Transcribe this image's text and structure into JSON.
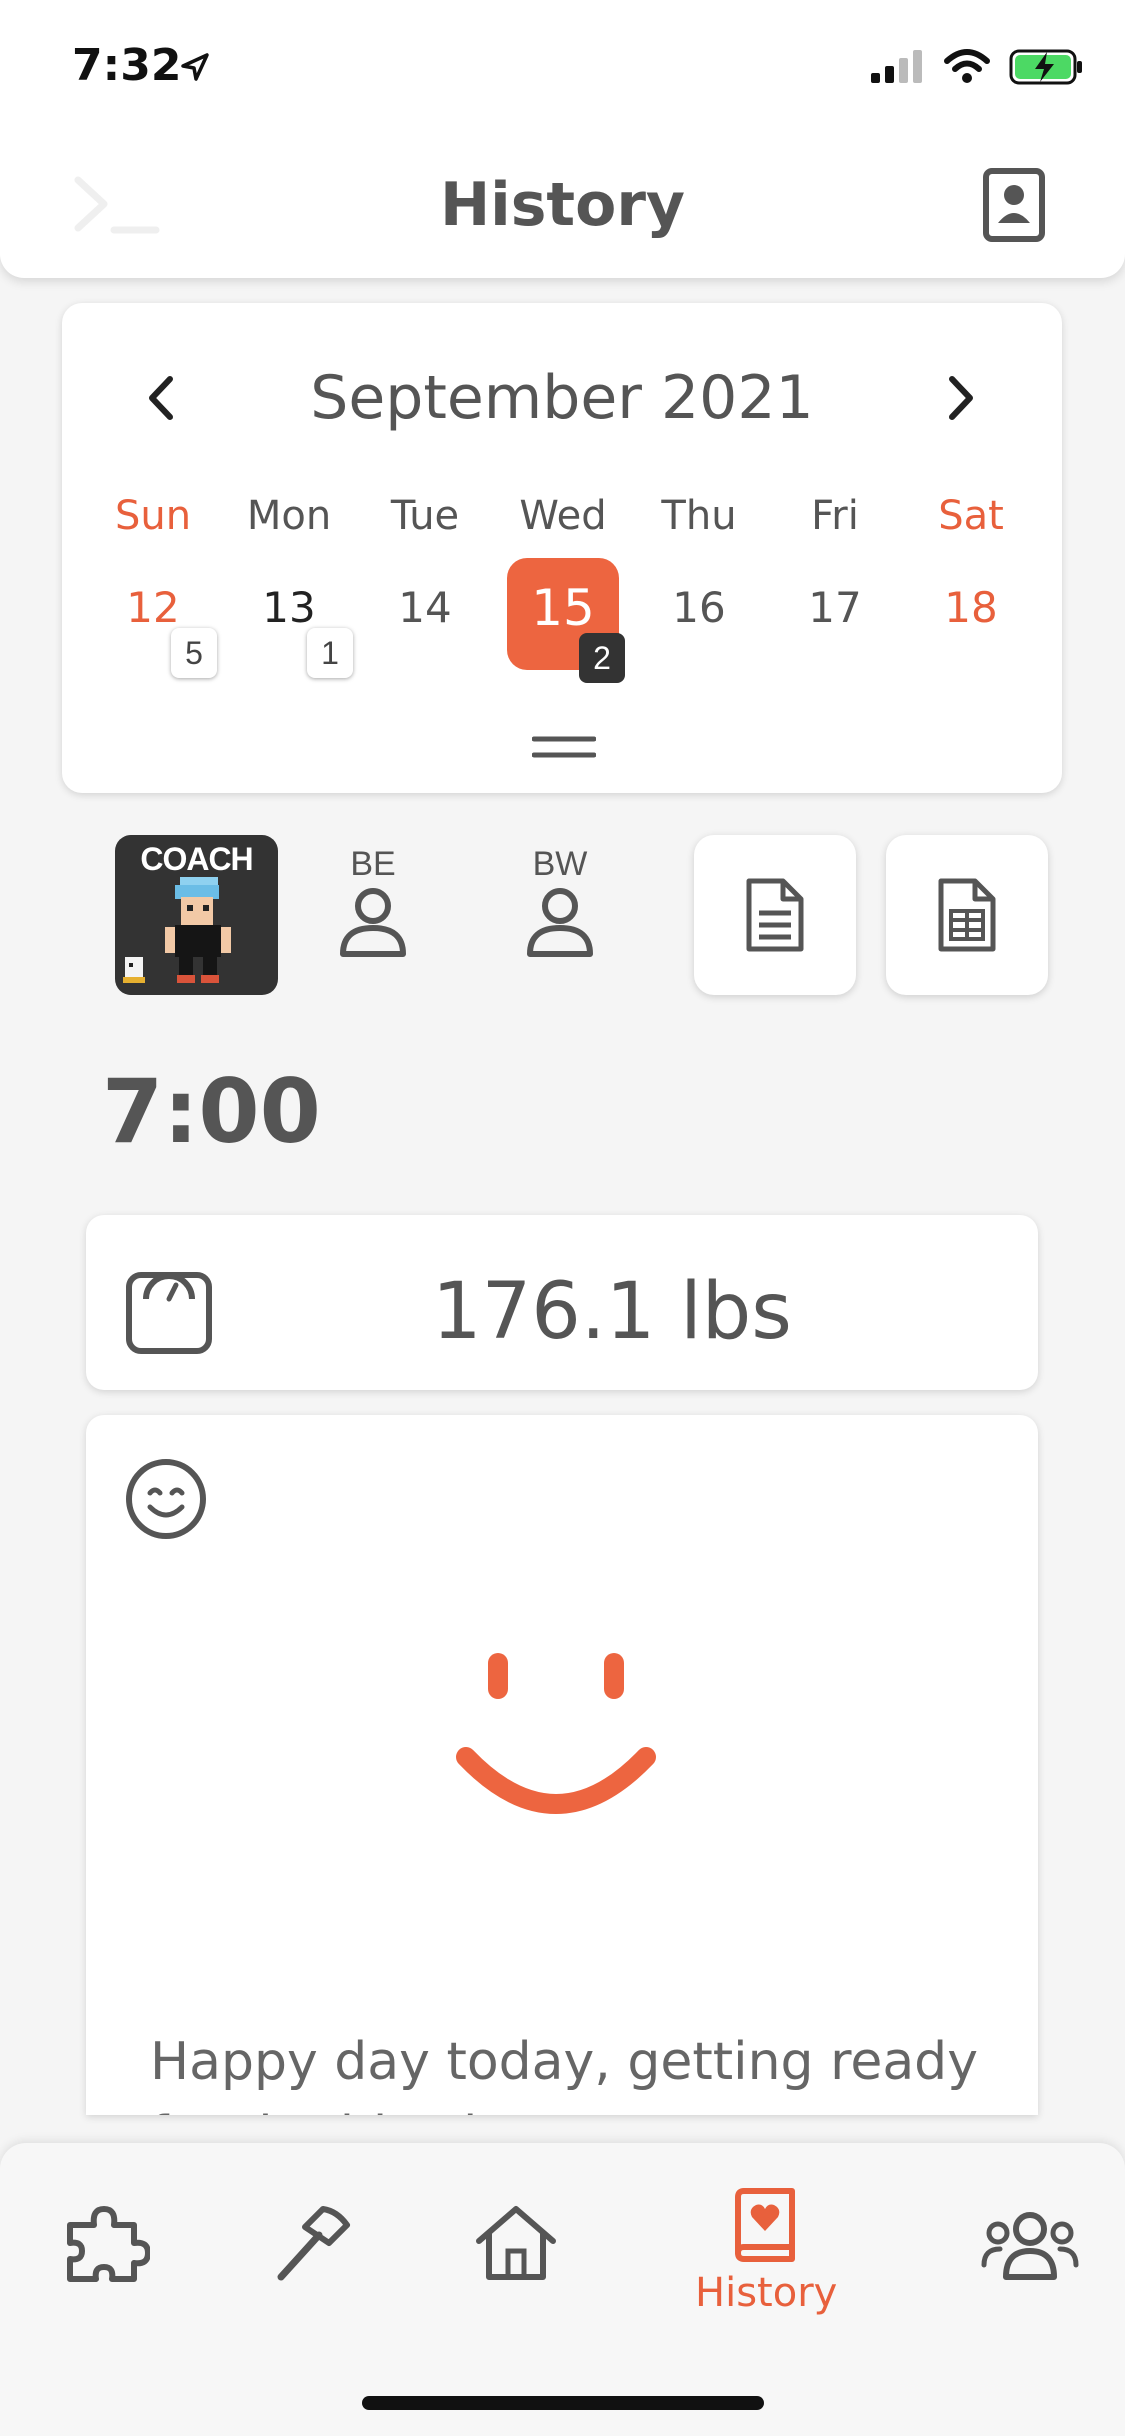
{
  "status_bar": {
    "time": "7:32"
  },
  "header": {
    "title": "History"
  },
  "calendar": {
    "month_label": "September 2021",
    "weekdays": [
      "Sun",
      "Mon",
      "Tue",
      "Wed",
      "Thu",
      "Fri",
      "Sat"
    ],
    "days": [
      "12",
      "13",
      "14",
      "15",
      "16",
      "17",
      "18"
    ],
    "selected_day": "15",
    "badges": {
      "sun": "5",
      "mon": "1",
      "wed": "2"
    }
  },
  "toolbar": {
    "coach_label": "COACH",
    "be_label": "BE",
    "bw_label": "BW"
  },
  "entry": {
    "time": "7:00",
    "weight": "176.1 lbs",
    "note": "Happy day today, getting ready for the big Fitness Fun"
  },
  "nav": {
    "history_label": "History"
  },
  "colors": {
    "accent": "#e8603c",
    "selected_day_bg": "#ed6540"
  }
}
